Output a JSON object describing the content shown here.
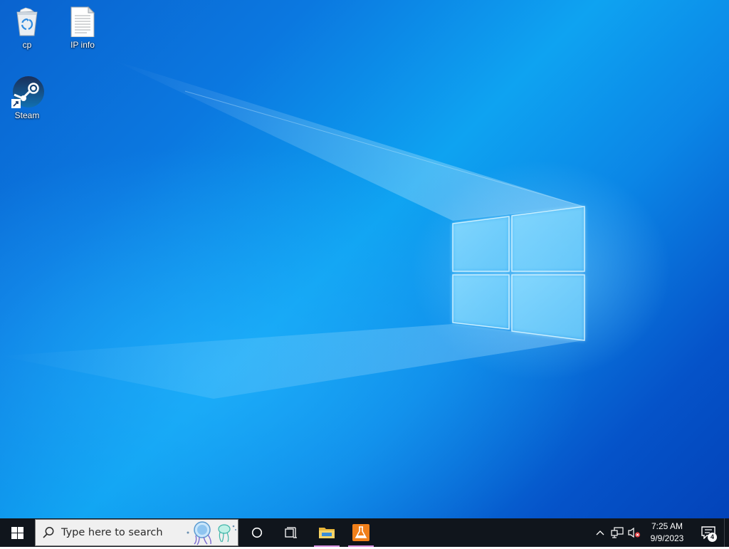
{
  "desktop": {
    "icons": [
      {
        "label": "cp",
        "icon": "recycle-bin-icon"
      },
      {
        "label": "IP info",
        "icon": "text-document-icon"
      },
      {
        "label": "Steam",
        "icon": "steam-icon"
      }
    ],
    "wallpaper_colors": {
      "deep": "#0343b9",
      "mid": "#0b78e0",
      "light": "#0ea3f1"
    }
  },
  "taskbar": {
    "background": "#10151c",
    "search": {
      "placeholder": "Type here to search"
    },
    "pinned_apps": [
      {
        "name": "File Explorer",
        "icon": "folder-icon",
        "running": true
      },
      {
        "name": "Lab",
        "icon": "flask-icon",
        "running": true
      }
    ],
    "running_indicator_color": "#d98fe0",
    "tray": {
      "icons": [
        "chevron-up-icon",
        "network-icon",
        "volume-muted-icon"
      ],
      "clock": {
        "time": "7:25 AM",
        "date": "9/9/2023"
      },
      "notification_count": "4"
    }
  }
}
